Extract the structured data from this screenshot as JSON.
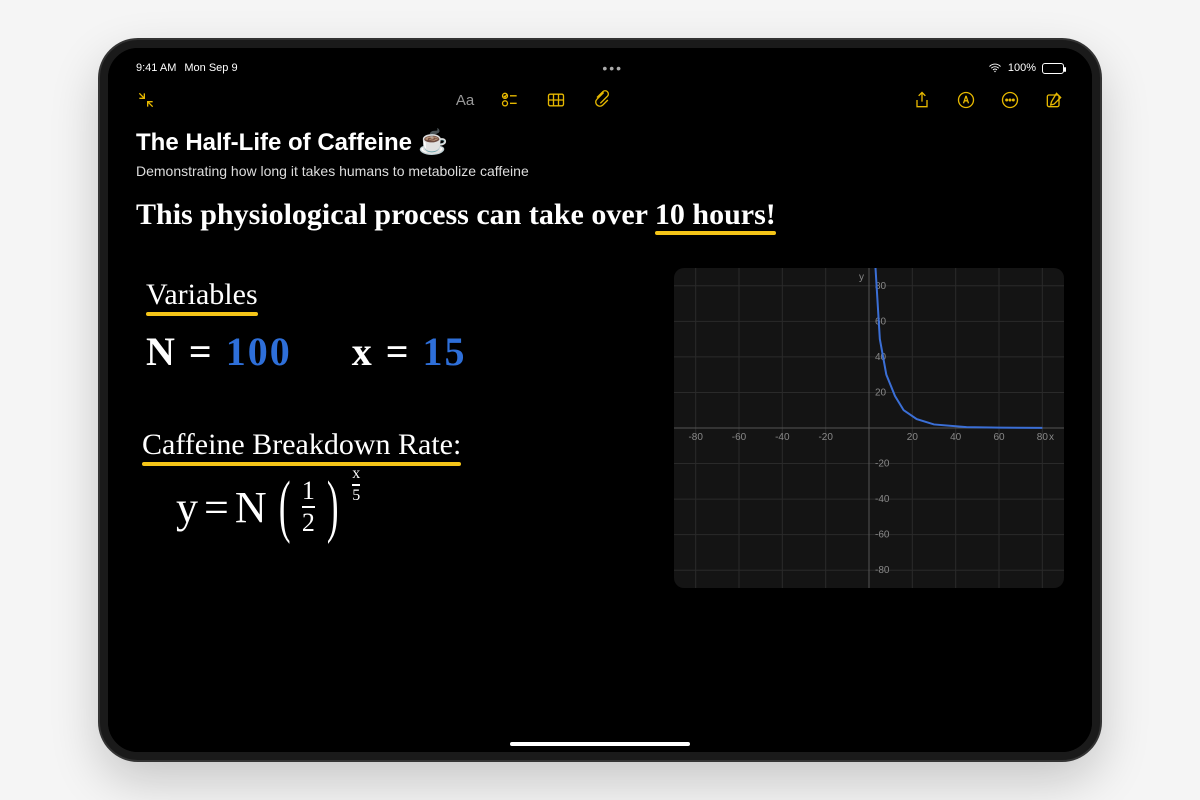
{
  "status": {
    "time": "9:41 AM",
    "date": "Mon Sep 9",
    "battery": "100%"
  },
  "toolbar": {
    "aa": "Aa"
  },
  "note": {
    "title": "The Half-Life of Caffeine",
    "emoji": "☕",
    "subtitle": "Demonstrating how long it takes humans to metabolize caffeine",
    "handwritten_line": "This physiological process can take over",
    "handwritten_emphasis": "10 hours!",
    "variables_label": "Variables",
    "var_n_lhs": "N =",
    "var_n_val": "100",
    "var_x_lhs": "x =",
    "var_x_val": "15",
    "rate_label": "Caffeine Breakdown Rate:",
    "formula_y": "y",
    "formula_eq": "=",
    "formula_N": "N",
    "frac_top": "1",
    "frac_bot": "2",
    "exp_top": "x",
    "exp_bot": "5"
  },
  "chart_data": {
    "type": "line",
    "xlabel": "x",
    "ylabel": "y",
    "x_ticks": [
      -80,
      -60,
      -40,
      -20,
      20,
      40,
      60,
      80
    ],
    "y_ticks": [
      -80,
      -60,
      -40,
      -20,
      20,
      40,
      60,
      80
    ],
    "xlim": [
      -90,
      90
    ],
    "ylim": [
      -90,
      90
    ],
    "series": [
      {
        "name": "y = N (1/2)^(x/5)",
        "points": [
          {
            "x": 3,
            "y": 90
          },
          {
            "x": 5,
            "y": 50
          },
          {
            "x": 8,
            "y": 30
          },
          {
            "x": 12,
            "y": 18
          },
          {
            "x": 16,
            "y": 10
          },
          {
            "x": 22,
            "y": 5
          },
          {
            "x": 30,
            "y": 2
          },
          {
            "x": 45,
            "y": 0.5
          },
          {
            "x": 60,
            "y": 0.2
          },
          {
            "x": 80,
            "y": 0.05
          }
        ]
      }
    ]
  }
}
